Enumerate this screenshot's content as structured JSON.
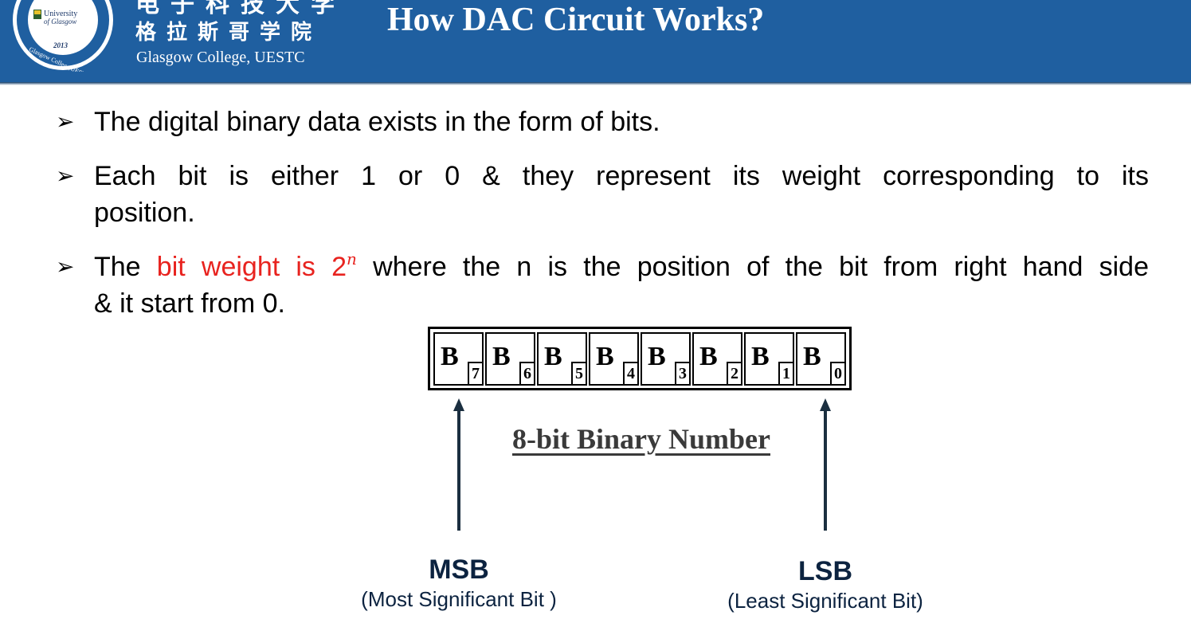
{
  "header": {
    "logo": {
      "lines": [
        "University",
        "of Glasgow",
        "2013",
        "Glasgow College,UESTC"
      ]
    },
    "brand_cn_top": "电子科技大学",
    "brand_cn": "格拉斯哥学院",
    "brand_en": "Glasgow College, UESTC",
    "title": "How DAC Circuit Works?"
  },
  "bullets": [
    {
      "text": "The digital binary data exists in the form of bits."
    },
    {
      "line1": "Each bit is either 1 or 0 & they represent its weight corresponding to its",
      "line2": "position."
    },
    {
      "pre": "The ",
      "red": "bit weight is 2",
      "sup": "n",
      "line1_rest": " where the n is the position of the bit from right hand side",
      "line2": "& it start from 0."
    }
  ],
  "diagram": {
    "bits": [
      {
        "letter": "B",
        "sub": "7"
      },
      {
        "letter": "B",
        "sub": "6"
      },
      {
        "letter": "B",
        "sub": "5"
      },
      {
        "letter": "B",
        "sub": "4"
      },
      {
        "letter": "B",
        "sub": "3"
      },
      {
        "letter": "B",
        "sub": "2"
      },
      {
        "letter": "B",
        "sub": "1"
      },
      {
        "letter": "B",
        "sub": "0"
      }
    ],
    "caption": "8-bit Binary Number",
    "msb": {
      "label": "MSB",
      "desc": "(Most Significant Bit )"
    },
    "lsb": {
      "label": "LSB",
      "desc": "(Least Significant Bit)"
    }
  },
  "colors": {
    "header_bg": "#1f5fa0",
    "highlight": "#e8231f",
    "label_text": "#0c2340"
  }
}
